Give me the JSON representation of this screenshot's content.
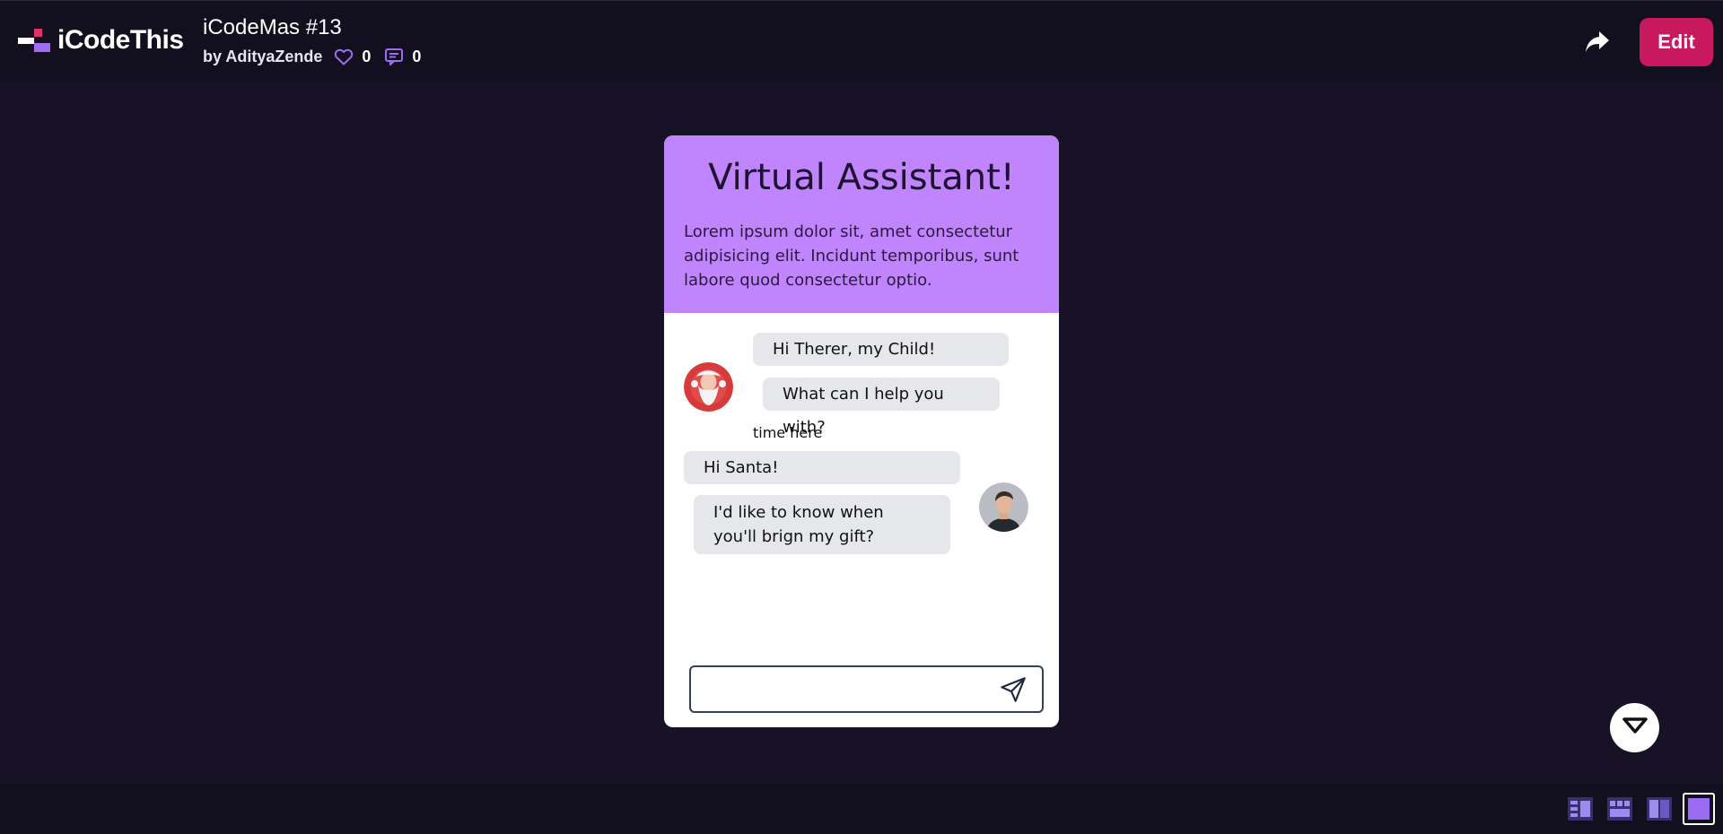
{
  "header": {
    "logo_text": "iCodeThis",
    "title": "iCodeMas #13",
    "author": "by AdityaZende",
    "likes": "0",
    "comments": "0",
    "edit_label": "Edit"
  },
  "card": {
    "title": "Virtual Assistant!",
    "description": "Lorem ipsum dolor sit, amet consectetur adipisicing elit. Incidunt temporibus, sunt labore quod consectetur optio.",
    "messages_left": [
      "Hi Therer, my Child!",
      "What can I help you with?"
    ],
    "time_label": "time here",
    "messages_right": [
      "Hi Santa!",
      "I'd like to know when you'll brign my gift?"
    ],
    "input_value": "",
    "input_placeholder": ""
  },
  "icons": {
    "logo": "icodethis-logo-icon",
    "like": "heart-icon",
    "comment": "comment-icon",
    "share": "share-arrow-icon",
    "send": "send-icon",
    "toggle": "chevron-down-icon",
    "santa_avatar": "santa-avatar",
    "user_avatar": "user-avatar"
  },
  "colors": {
    "background": "#181227",
    "bar": "#120f1e",
    "accent": "#c8195e",
    "card_header": "#c084fc",
    "bubble": "#e5e7eb",
    "icon_purple": "#9f6cf3"
  }
}
